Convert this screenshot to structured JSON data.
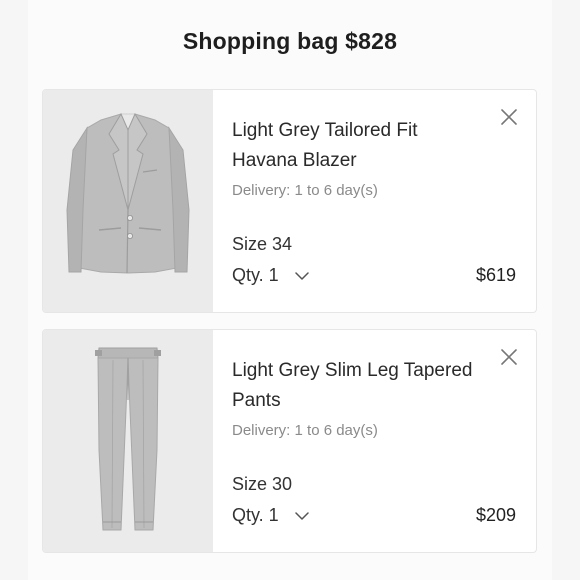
{
  "header": {
    "title": "Shopping bag $828"
  },
  "items": [
    {
      "name_line1": "Light Grey Tailored Fit",
      "name_line2": "Havana Blazer",
      "delivery": "Delivery: 1 to 6 day(s)",
      "size": "Size 34",
      "qty": "Qty. 1",
      "price": "$619",
      "icon_remove": "close-icon",
      "icon_qty": "chevron-down-icon"
    },
    {
      "name_line1": "Light Grey Slim Leg Tapered",
      "name_line2": "Pants",
      "delivery": "Delivery: 1 to 6 day(s)",
      "size": "Size 30",
      "qty": "Qty. 1",
      "price": "$209",
      "icon_remove": "close-icon",
      "icon_qty": "chevron-down-icon"
    }
  ],
  "colors": {
    "background": "#f6f6f6",
    "card": "#ffffff",
    "thumb_bg": "#ebebeb",
    "muted_text": "#8a8a8a",
    "garment_grey": "#b9b9b9"
  }
}
